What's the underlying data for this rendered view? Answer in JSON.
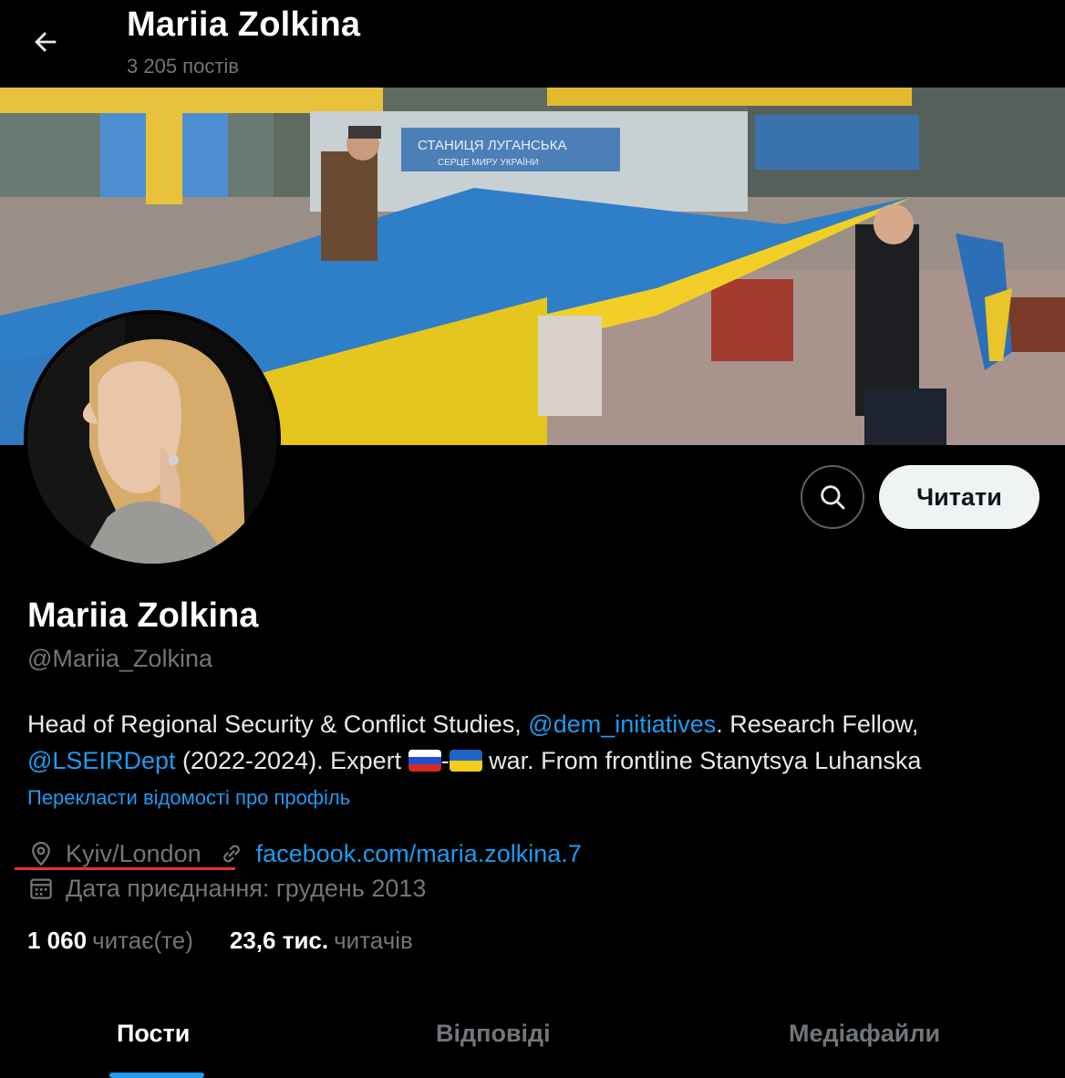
{
  "header": {
    "title": "Mariia Zolkina",
    "posts_count": "3 205 постів"
  },
  "banner": {
    "sign_line1": "СТАНИЦЯ ЛУГАНСЬКА",
    "sign_line2": "СЕРЦЕ  МИРУ  УКРАЇНИ"
  },
  "actions": {
    "follow_label": "Читати"
  },
  "profile": {
    "name": "Mariia Zolkina",
    "handle": "@Mariia_Zolkina",
    "bio": {
      "part1": "Head of Regional Security & Conflict Studies, ",
      "mention1": "@dem_initiatives",
      "part2": ". Research Fellow, ",
      "mention2": "@LSEIRDept",
      "part3": " (2022-2024). Expert ",
      "part4": "-",
      "part5": " war. From frontline Stanytsya Luhanska"
    },
    "translate_label": "Перекласти відомості про профіль",
    "location": "Kyiv/London",
    "website": "facebook.com/maria.zolkina.7",
    "joined": "Дата приєднання: грудень 2013"
  },
  "stats": {
    "following_count": "1 060",
    "following_label": "читає(те)",
    "followers_count": "23,6 тис.",
    "followers_label": "читачів"
  },
  "tabs": [
    {
      "label": "Пости",
      "active": true
    },
    {
      "label": "Відповіді",
      "active": false
    },
    {
      "label": "Медіафайли",
      "active": false
    }
  ],
  "colors": {
    "background": "#000000",
    "accent": "#1d9bf0",
    "muted": "#71767b",
    "highlight_underline": "#e3342f",
    "flag_blue": "#1f63c9",
    "flag_yellow": "#f2cd1a"
  },
  "icons": [
    "arrow-left-icon",
    "search-icon",
    "location-pin-icon",
    "link-icon",
    "calendar-icon"
  ]
}
